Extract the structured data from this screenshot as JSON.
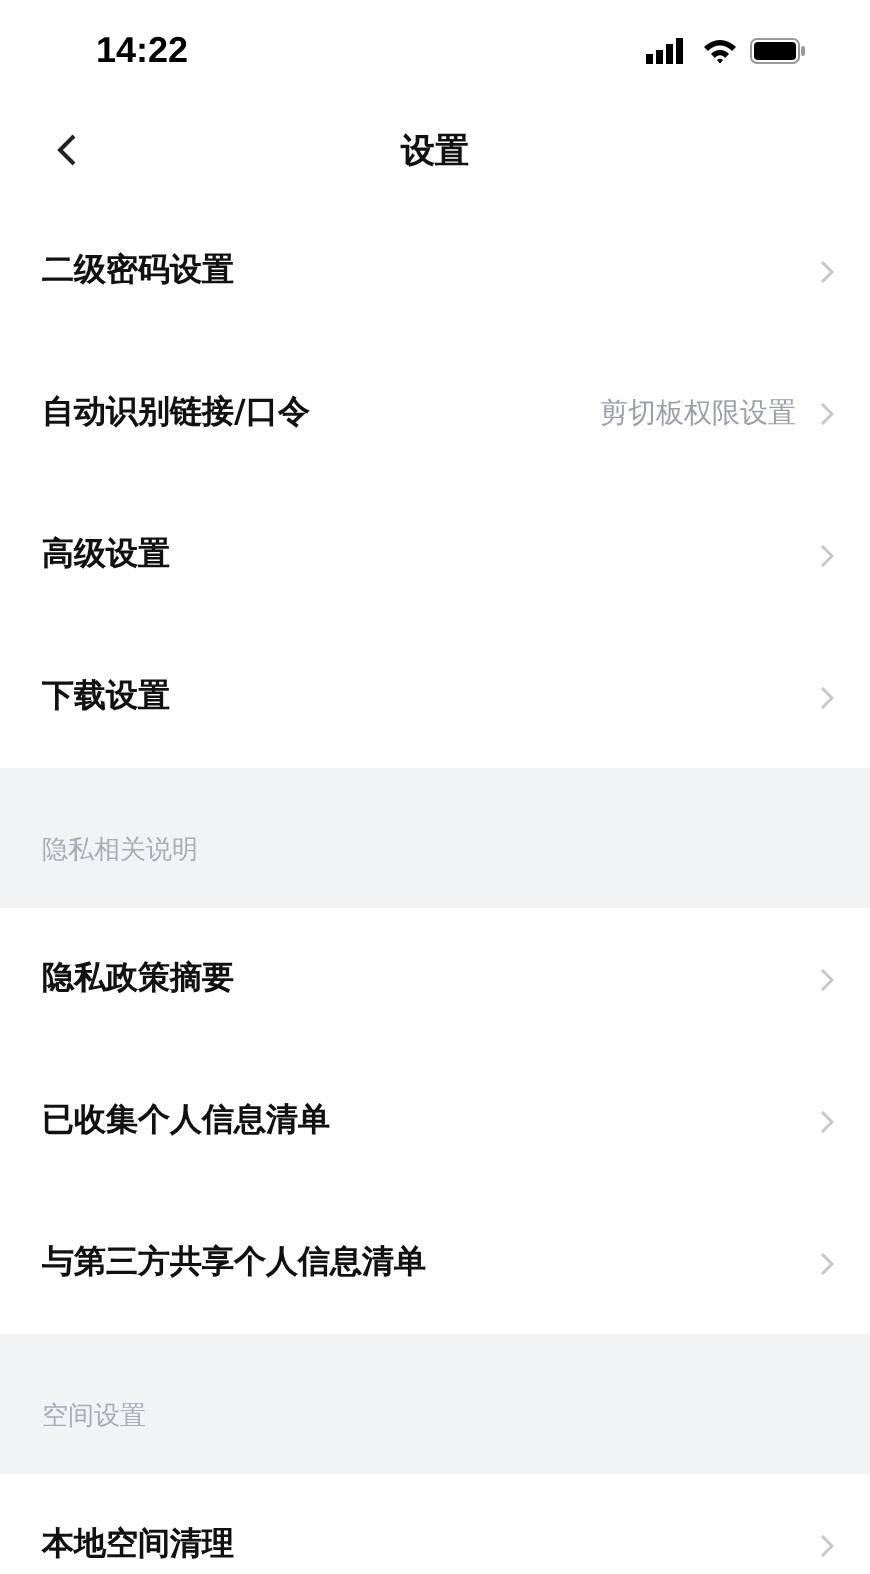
{
  "status_bar": {
    "time": "14:22"
  },
  "nav": {
    "title": "设置"
  },
  "rows": [
    {
      "kind": "row",
      "label": "二级密码设置"
    },
    {
      "kind": "row",
      "label": "自动识别链接/口令",
      "value": "剪切板权限设置"
    },
    {
      "kind": "row",
      "label": "高级设置"
    },
    {
      "kind": "row",
      "label": "下载设置"
    },
    {
      "kind": "section",
      "label": "隐私相关说明"
    },
    {
      "kind": "row",
      "label": "隐私政策摘要"
    },
    {
      "kind": "row",
      "label": "已收集个人信息清单"
    },
    {
      "kind": "row",
      "label": "与第三方共享个人信息清单"
    },
    {
      "kind": "section",
      "label": "空间设置"
    },
    {
      "kind": "row",
      "label": "本地空间清理"
    }
  ]
}
